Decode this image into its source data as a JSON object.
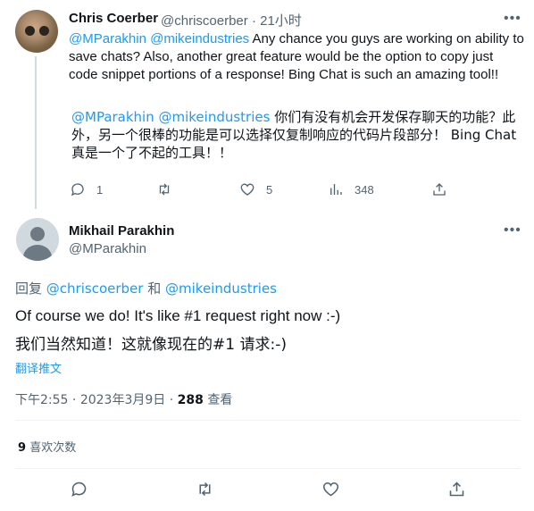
{
  "tweet1": {
    "author_name": "Chris Coerber",
    "handle": "@chriscoerber",
    "separator": "·",
    "time": "21小时",
    "body_mentions": "@MParakhin @mikeindustries",
    "body_text": " Any chance you guys are working on ability to save chats? Also, another great feature would be the option to copy just code snippet portions of a response! Bing Chat is such an amazing tool!!",
    "translation_mentions": "@MParakhin @mikeindustries",
    "translation_text": " 你们有没有机会开发保存聊天的功能？此外，另一个很棒的功能是可以选择仅复制响应的代码片段部分！ Bing Chat 真是一个了不起的工具！！",
    "replies": "1",
    "retweets": "",
    "likes": "5",
    "views": "348",
    "more_icon": "more-icon"
  },
  "tweet2": {
    "author_name": "Mikhail Parakhin",
    "handle": "@MParakhin",
    "reply_prefix": "回复",
    "reply_user1": "@chriscoerber",
    "reply_and": "和",
    "reply_user2": "@mikeindustries",
    "text_en": "Of course we do! It's like #1 request right now :-)",
    "text_zh": "我们当然知道！这就像现在的#1 请求:-)",
    "translate_link": "翻译推文",
    "time": "下午2:55",
    "date": "2023年3月9日",
    "dot": "·",
    "views_count": "288",
    "views_label": "查看",
    "likes_count": "9",
    "likes_label": "喜欢次数"
  },
  "colors": {
    "accent": "#1d9bf0",
    "muted": "#536471",
    "text": "#0f1419"
  }
}
